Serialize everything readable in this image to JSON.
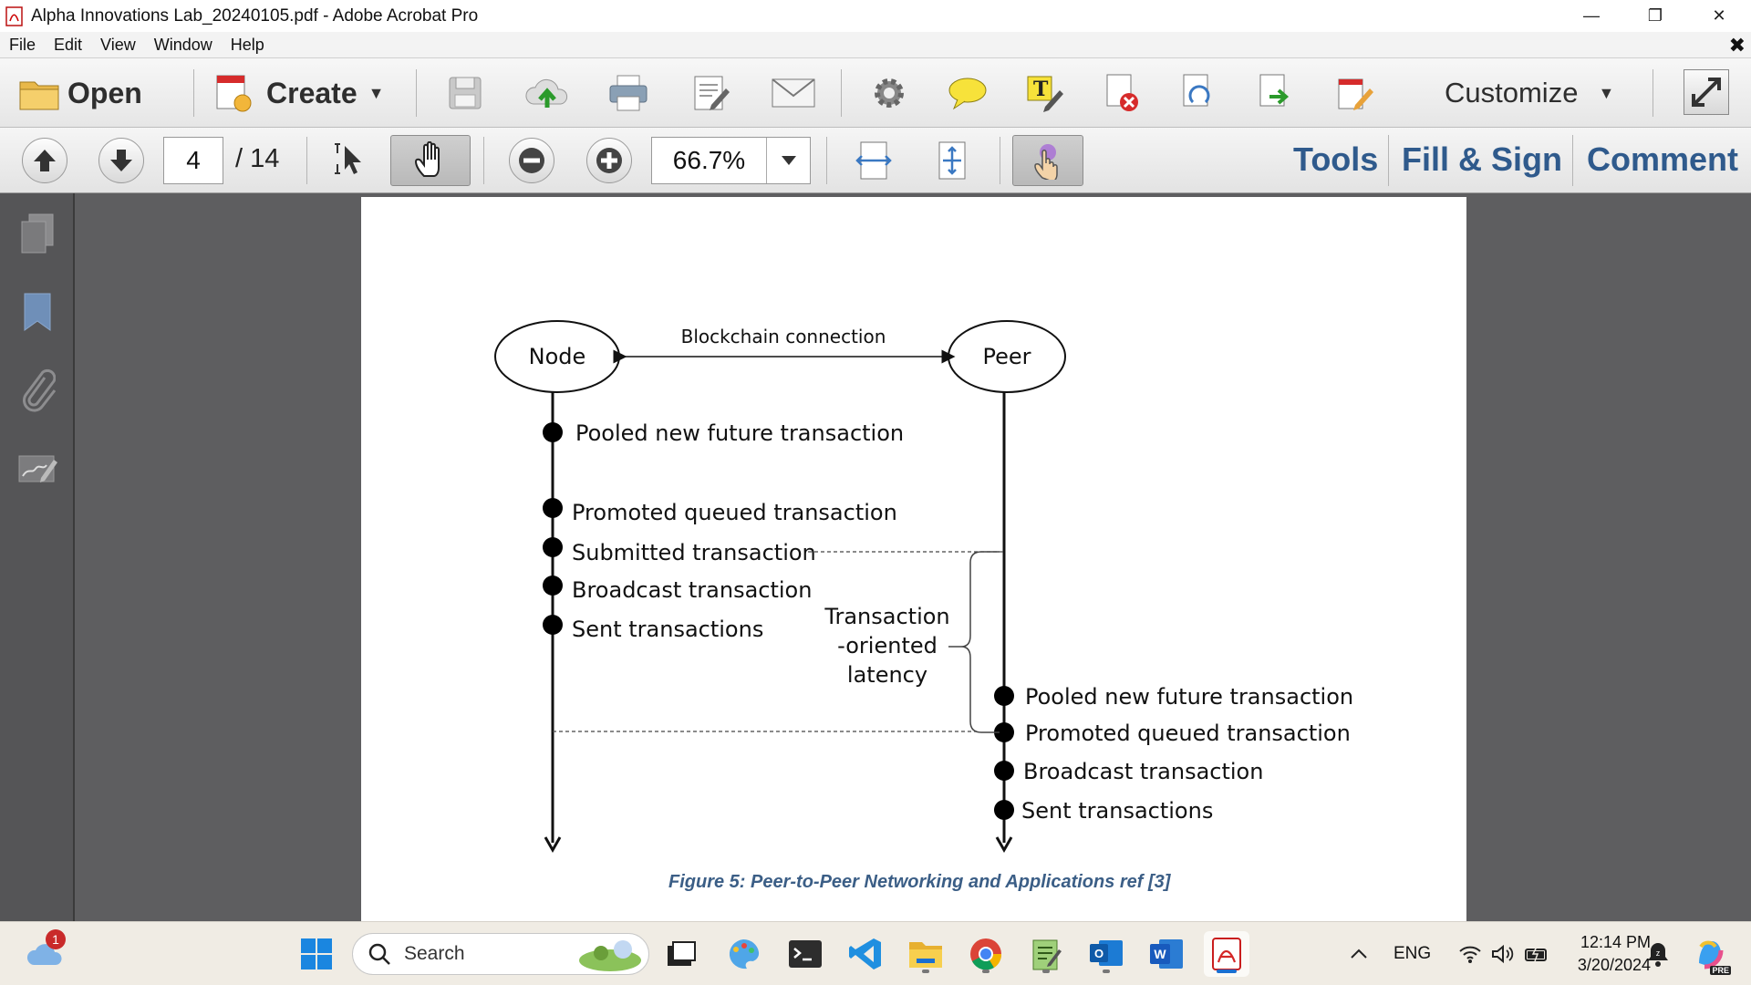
{
  "window": {
    "title": "Alpha Innovations Lab_20240105.pdf - Adobe Acrobat Pro",
    "minimize_label": "—",
    "restore_label": "❐",
    "close_label": "✕"
  },
  "menubar": {
    "items": [
      "File",
      "Edit",
      "View",
      "Window",
      "Help"
    ],
    "close_doc_label": "✖"
  },
  "toolbar1": {
    "open_label": "Open",
    "create_label": "Create",
    "customize_label": "Customize"
  },
  "toolbar2": {
    "page_current": "4",
    "page_total": "/ 14",
    "zoom": "66.7%",
    "panes": [
      "Tools",
      "Fill & Sign",
      "Comment"
    ]
  },
  "diagram": {
    "node_label": "Node",
    "peer_label": "Peer",
    "connection_label": "Blockchain connection",
    "node_events": [
      "Pooled new future transaction",
      "Promoted queued transaction",
      "Submitted transaction",
      "Broadcast transaction",
      "Sent transactions"
    ],
    "peer_events": [
      "Pooled new future transaction",
      "Promoted queued transaction",
      "Broadcast transaction",
      "Sent transactions"
    ],
    "latency_lines": [
      "Transaction",
      "-oriented",
      "latency"
    ],
    "caption": "Figure 5: Peer-to-Peer Networking and Applications ref [3]"
  },
  "taskbar": {
    "search_placeholder": "Search",
    "notification_count": "1",
    "language": "ENG",
    "time": "12:14 PM",
    "date": "3/20/2024",
    "copilot_badge": "PRE"
  }
}
